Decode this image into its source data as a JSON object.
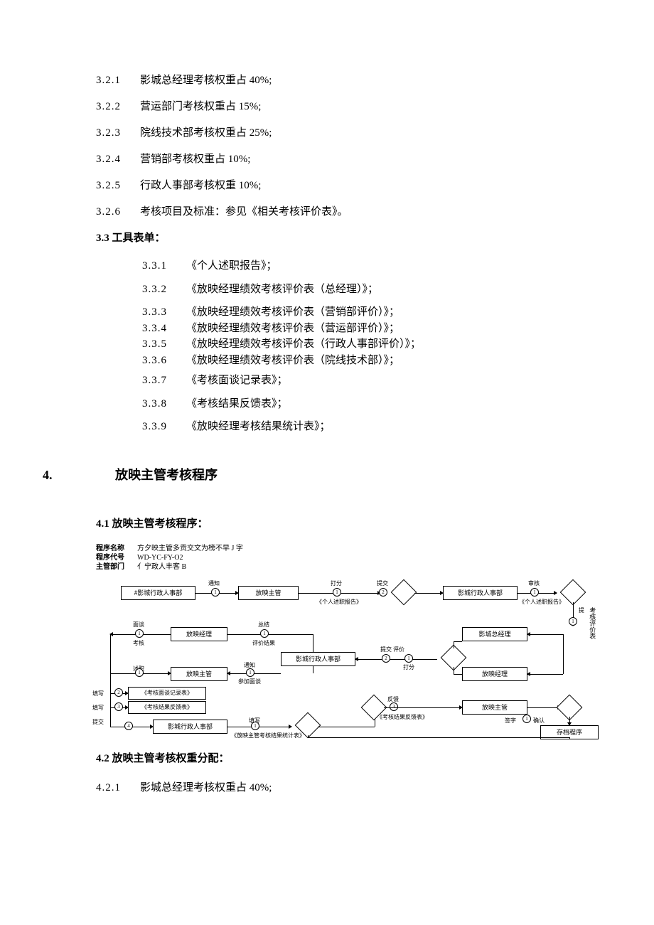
{
  "section3": {
    "items": [
      {
        "num": "3.2.1",
        "text": "影城总经理考核权重占 40%;"
      },
      {
        "num": "3.2.2",
        "text": "营运部门考核权重占 15%;"
      },
      {
        "num": "3.2.3",
        "text": "院线技术部考核权重占 25%;"
      },
      {
        "num": "3.2.4",
        "text": "营销部考核权重占 10%;"
      },
      {
        "num": "3.2.5",
        "text": "行政人事部考核权重 10%;"
      },
      {
        "num": "3.2.6",
        "text": "考核项目及标准：参见《相关考核评价表》。"
      }
    ],
    "sub33_title": "3.3  工具表单：",
    "sub33_items": [
      {
        "num": "3.3.1",
        "text": "《个人述职报告》；"
      },
      {
        "num": "3.3.2",
        "text": "《放映经理绩效考核评价表（总经理）》；"
      },
      {
        "num": "3.3.3",
        "text": "《放映经理绩效考核评价表（营销部评价）》；"
      },
      {
        "num": "3.3.4",
        "text": "《放映经理绩效考核评价表（营运部评价）》；"
      },
      {
        "num": "3.3.5",
        "text": "《放映经理绩效考核评价表（行政人事部评价）》；"
      },
      {
        "num": "3.3.6",
        "text": "《放映经理绩效考核评价表（院线技术部）》；"
      },
      {
        "num": "3.3.7",
        "text": "《考核面谈记录表》；"
      },
      {
        "num": "3.3.8",
        "text": "《考核结果反馈表》；"
      },
      {
        "num": "3.3.9",
        "text": "《放映经理考核结果统计表》；"
      }
    ]
  },
  "section4": {
    "num": "4.",
    "title": "放映主管考核程序",
    "sub41_title": "4.1  放映主管考核程序：",
    "sub42_title": "4.2  放映主管考核权重分配：",
    "sub42_items": [
      {
        "num": "4.2.1",
        "text": "影城总经理考核权重占 40%;"
      }
    ]
  },
  "diagram": {
    "header_labels": [
      "程序名称",
      "程序代号",
      "主管部门"
    ],
    "header_values": [
      "方夕映主管多贡交文为榜不早 J 字",
      "WD-YC-FY-O2",
      "亻宁政人丰客 B"
    ],
    "boxes": {
      "r1b1": "#影城行政人事部",
      "r1b2": "放映主管",
      "r1b3": "影城行政人事部",
      "r2b1": "放映经理",
      "r2b3": "影城总经理",
      "r3b1": "影城行政人事部",
      "r3b2": "放映经理",
      "r4b1": "放映主管",
      "r5b1": "影城行政人事部",
      "r5b2": "放映主管",
      "r5b3": "存档程序"
    },
    "labels": {
      "tongzhi": "通知",
      "dafen": "打分",
      "tijiao": "提交",
      "shenhe": "审核",
      "gerenbaogao": "《个人述职报告》",
      "miantan": "面谈",
      "kaohe": "考核",
      "zonghe": "总结",
      "pingjia": "评价结果",
      "tijiaopj": "提交 评价",
      "shuzhi": "述职",
      "canjia": "参加面谈",
      "tianxie": "填写",
      "mantanjilu": "《考核面谈记录表》",
      "jieguofankui": "《考核结果反馈表》",
      "fankui": "反馈",
      "jieguotongji": "《放映主管考核结果统计表》",
      "qianzi": "签字",
      "queren": "确认",
      "pingjiabiao": "考核评价表"
    }
  }
}
